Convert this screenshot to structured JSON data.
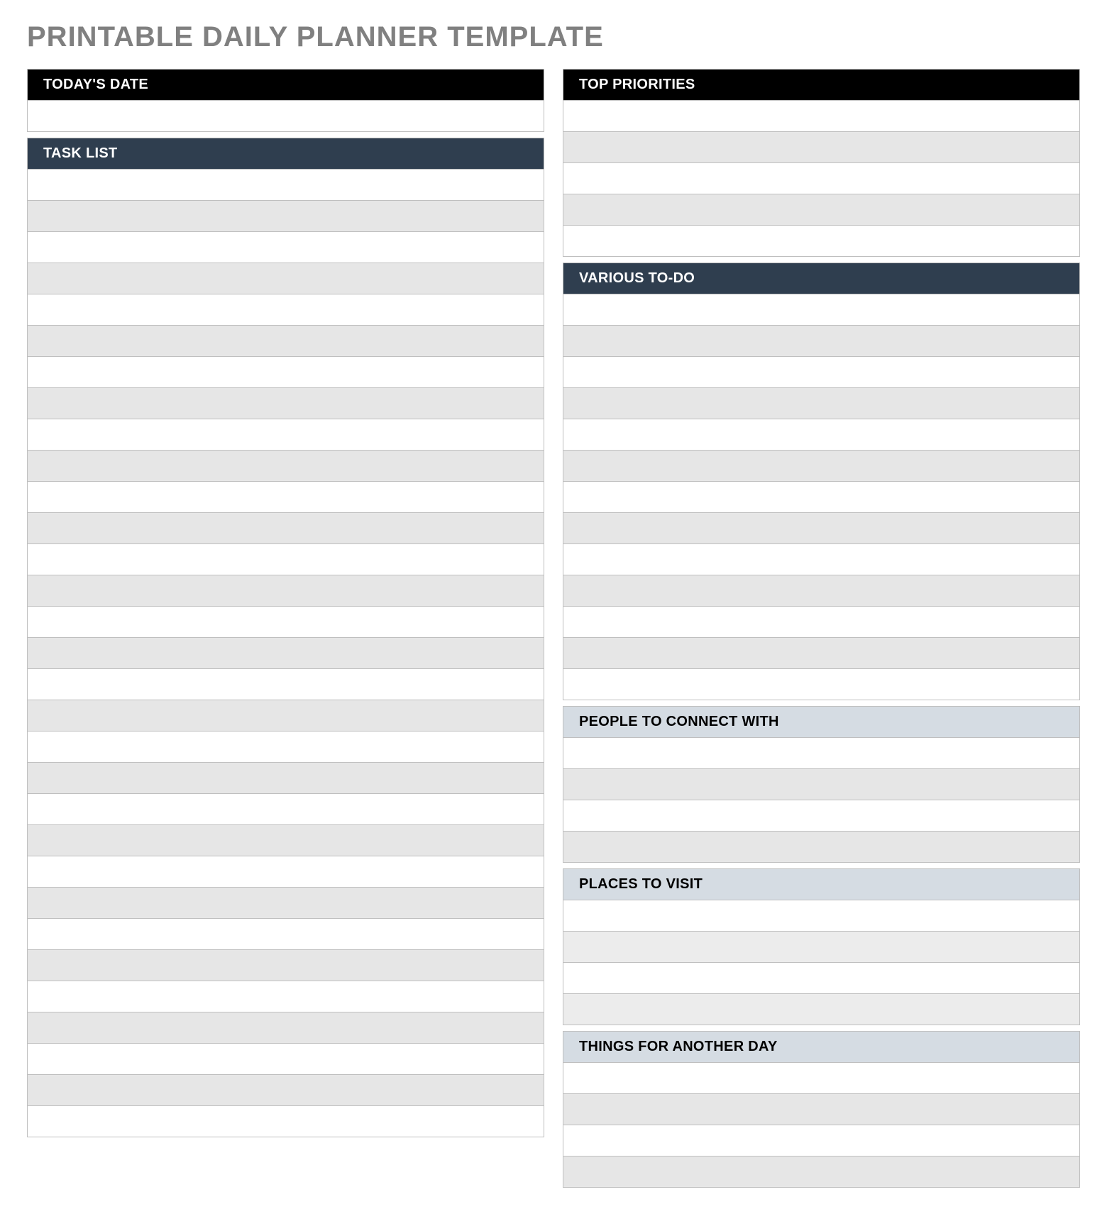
{
  "title": "PRINTABLE DAILY PLANNER TEMPLATE",
  "left": {
    "todays_date": {
      "label": "TODAY'S DATE",
      "value": ""
    },
    "task_list": {
      "label": "TASK LIST",
      "rows": [
        "",
        "",
        "",
        "",
        "",
        "",
        "",
        "",
        "",
        "",
        "",
        "",
        "",
        "",
        "",
        "",
        "",
        "",
        "",
        "",
        "",
        "",
        "",
        "",
        "",
        "",
        "",
        "",
        "",
        "",
        ""
      ]
    }
  },
  "right": {
    "top_priorities": {
      "label": "TOP PRIORITIES",
      "rows": [
        "",
        "",
        "",
        "",
        ""
      ]
    },
    "various_todo": {
      "label": "VARIOUS TO-DO",
      "rows": [
        "",
        "",
        "",
        "",
        "",
        "",
        "",
        "",
        "",
        "",
        "",
        "",
        ""
      ]
    },
    "people": {
      "label": "PEOPLE TO CONNECT WITH",
      "rows": [
        "",
        "",
        "",
        ""
      ]
    },
    "places": {
      "label": "PLACES TO VISIT",
      "rows": [
        "",
        "",
        "",
        ""
      ]
    },
    "another_day": {
      "label": "THINGS FOR ANOTHER DAY",
      "rows": [
        "",
        "",
        "",
        ""
      ]
    }
  }
}
